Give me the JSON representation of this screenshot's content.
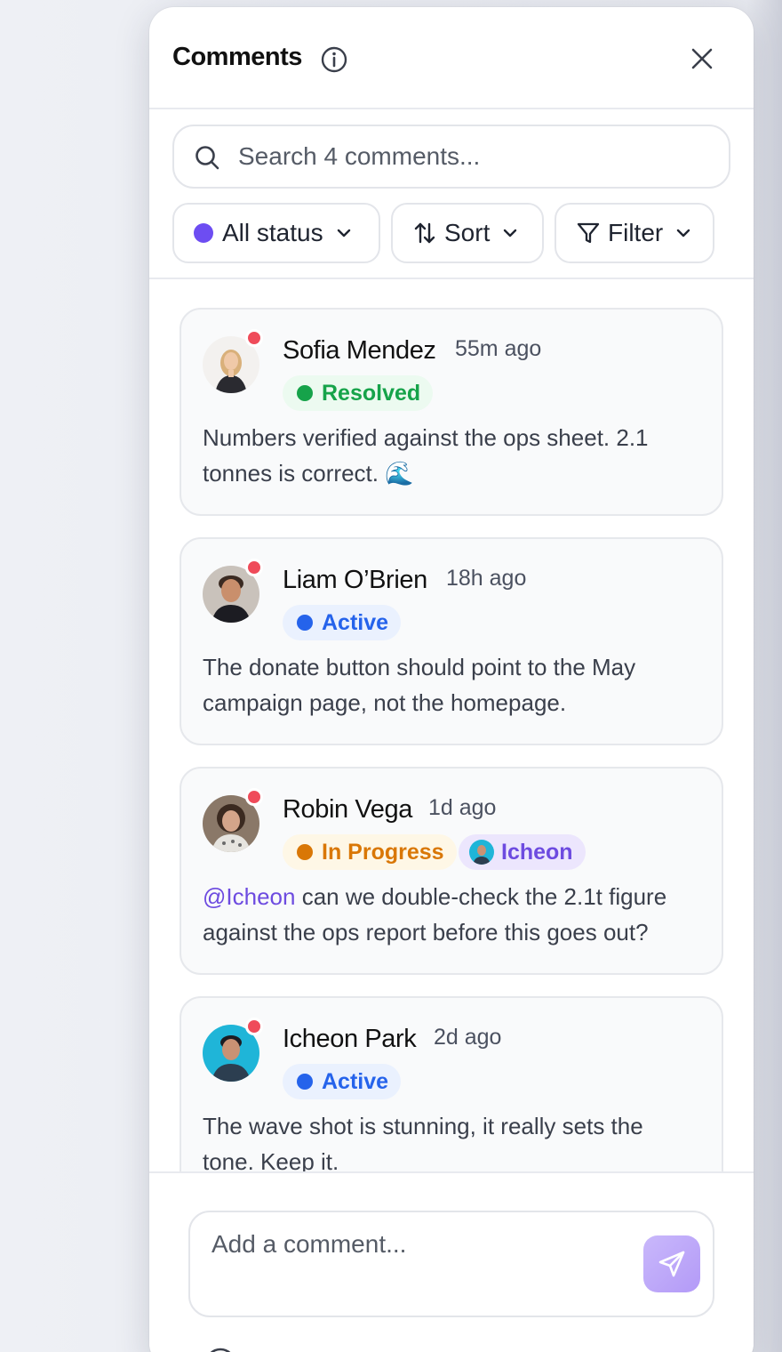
{
  "panel": {
    "title": "Comments",
    "info_icon": "info-circle-icon",
    "close_icon": "close-icon"
  },
  "search": {
    "placeholder": "Search 4 comments...",
    "icon": "search-icon"
  },
  "toolbar": {
    "status_label": "All status",
    "status_color": "#6d4df2",
    "sort_label": "Sort",
    "filter_label": "Filter"
  },
  "comments": [
    {
      "author": "Sofia Mendez",
      "time": "55m ago",
      "status": "Resolved",
      "status_color": "#16a34a",
      "text": "Numbers verified against the ops sheet. 2.1 tonnes is correct. 🌊",
      "unread": true
    },
    {
      "author": "Liam O’Brien",
      "time": "18h ago",
      "status": "Active",
      "status_color": "#2563eb",
      "text": "The donate button should point to the May campaign page, not the homepage.",
      "unread": true
    },
    {
      "author": "Robin Vega",
      "time": "1d ago",
      "status": "In Progress",
      "status_color": "#d97706",
      "assignee": "Icheon",
      "mention": "@Icheon",
      "text": " can we double-check the 2.1t figure against the ops report before this goes out?",
      "unread": true
    },
    {
      "author": "Icheon Park",
      "time": "2d ago",
      "status": "Active",
      "status_color": "#2563eb",
      "text": "The wave shot is stunning, it really sets the tone. Keep it.",
      "unread": true
    }
  ],
  "composer": {
    "placeholder": "Add a comment...",
    "send_icon": "send-icon",
    "accent": "#b39af7"
  }
}
